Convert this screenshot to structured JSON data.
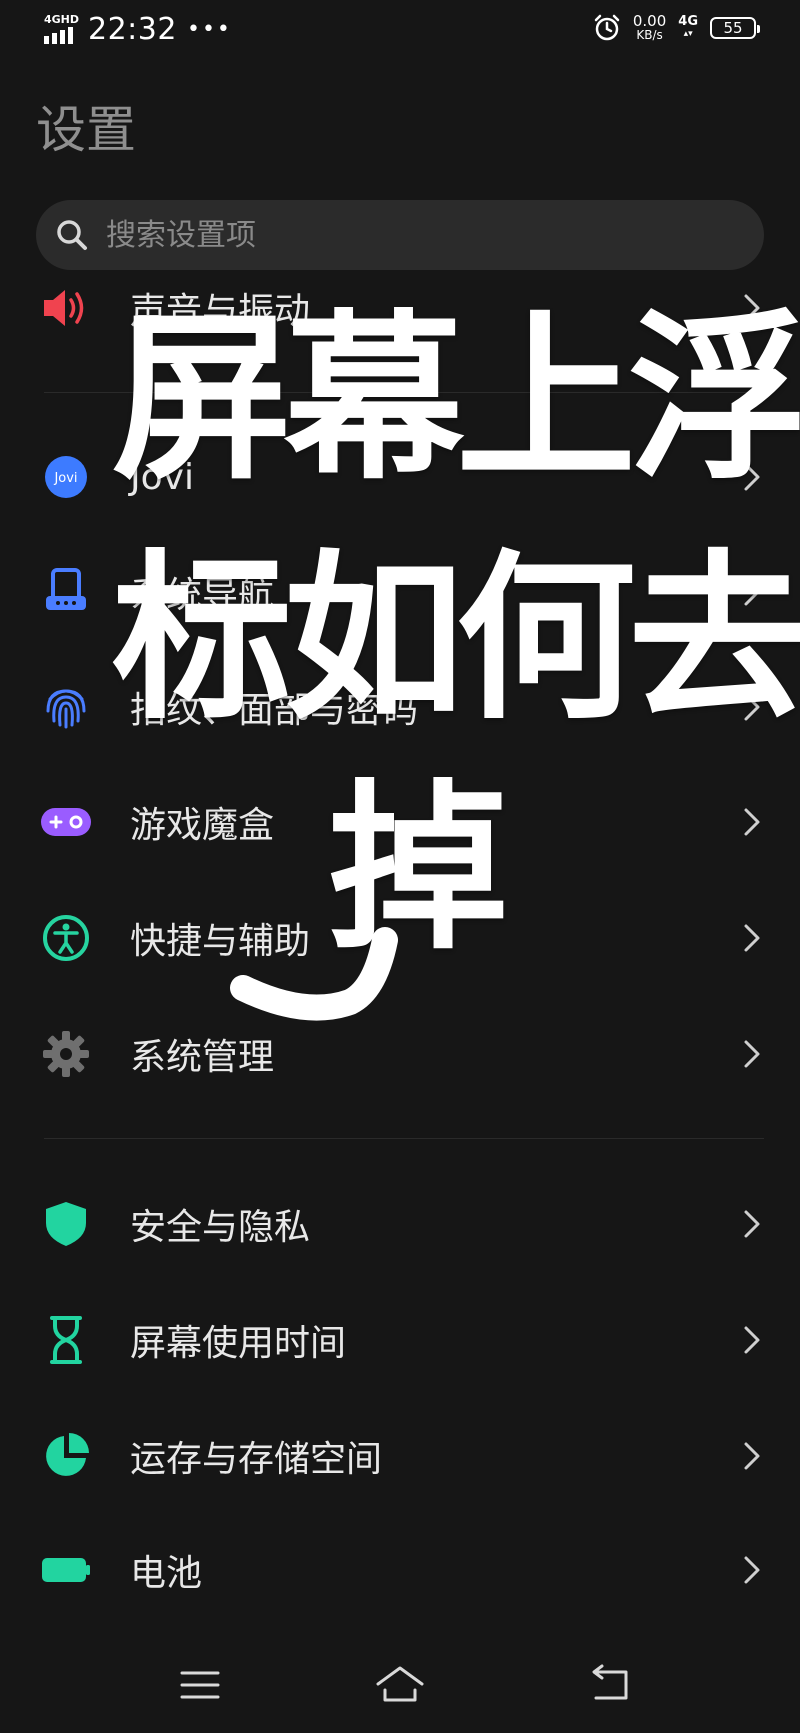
{
  "status_bar": {
    "network_label": "4GHD",
    "time": "22:32",
    "more": "•••",
    "speed_value": "0.00",
    "speed_unit": "KB/s",
    "data_network": "4G",
    "battery_level": "55"
  },
  "page": {
    "title": "设置",
    "search_placeholder": "搜索设置项"
  },
  "settings": [
    {
      "label": "声音与振动",
      "icon": "speaker-icon",
      "color": "#f0434f"
    },
    {
      "label": "Jovi",
      "icon": "jovi-icon",
      "color": "#3d7bff"
    },
    {
      "label": "系统导航",
      "icon": "system-navigation-icon",
      "color": "#4a7dff"
    },
    {
      "label": "指纹、面部与密码",
      "icon": "fingerprint-icon",
      "color": "#4a7dff"
    },
    {
      "label": "游戏魔盒",
      "icon": "gamepad-icon",
      "color": "#9a5cff"
    },
    {
      "label": "快捷与辅助",
      "icon": "accessibility-icon",
      "color": "#26d4a0"
    },
    {
      "label": "系统管理",
      "icon": "gear-icon",
      "color": "#7a7a7a"
    },
    {
      "label": "安全与隐私",
      "icon": "shield-icon",
      "color": "#22d4a0"
    },
    {
      "label": "屏幕使用时间",
      "icon": "hourglass-icon",
      "color": "#22d4a0"
    },
    {
      "label": "运存与存储空间",
      "icon": "pie-chart-icon",
      "color": "#22d4a0"
    },
    {
      "label": "电池",
      "icon": "battery-icon",
      "color": "#22d4a0"
    }
  ],
  "overlay": {
    "line1": "屏幕上浮",
    "line2": "标如何去",
    "line3": "掉"
  },
  "nav_bar": {
    "menu": "menu-icon",
    "home": "home-icon",
    "back": "back-icon"
  }
}
